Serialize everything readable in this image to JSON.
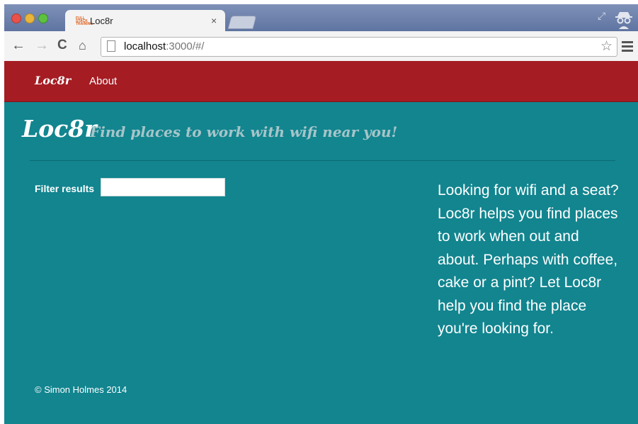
{
  "browser": {
    "tab": {
      "favicon_text": "FULL STACK TRAINING",
      "title": "Loc8r",
      "close": "×"
    },
    "url": {
      "host": "localhost",
      "rest": ":3000/#/"
    },
    "icons": [
      "back-icon",
      "forward-icon",
      "reload-icon",
      "home-icon",
      "page-icon",
      "star-icon",
      "menu-icon",
      "incognito-icon",
      "expand-icon"
    ]
  },
  "navbar": {
    "brand": "Loc8r",
    "about": "About"
  },
  "page": {
    "heading": "Loc8r",
    "strapline": "Find places to work with wifi near you!",
    "filter_label": "Filter results",
    "filter_value": "",
    "sidebar": "Looking for wifi and a seat? Loc8r helps you find places to work when out and about. Perhaps with coffee, cake or a pint? Let Loc8r help you find the place you're looking for.",
    "footer": "© Simon Holmes 2014"
  },
  "colors": {
    "navbar": "#a51c23",
    "page_bg": "#12858f",
    "strapline": "#a7c5c9"
  }
}
